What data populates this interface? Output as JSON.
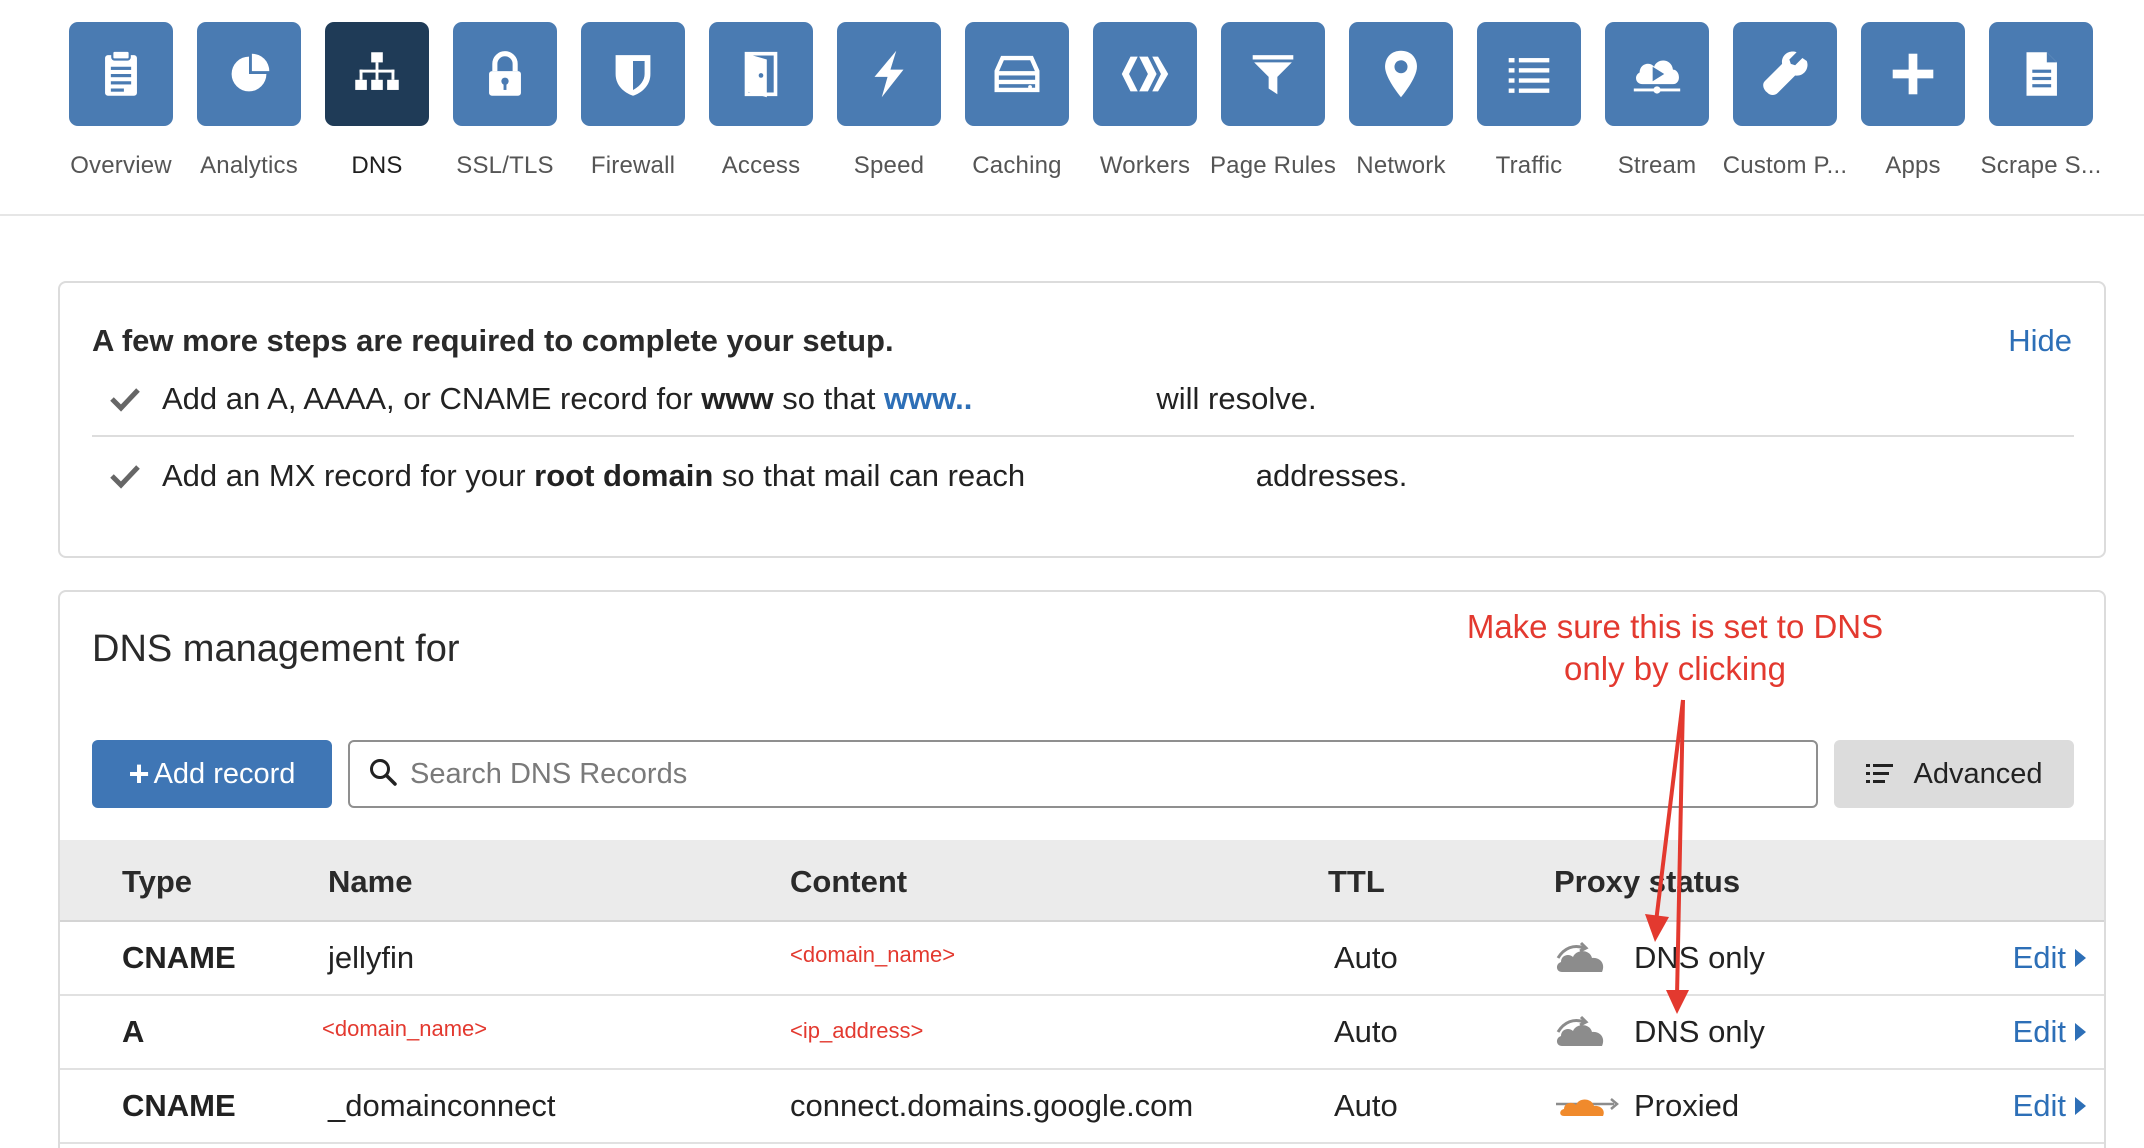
{
  "nav": {
    "items": [
      {
        "label": "Overview",
        "icon": "clipboard-icon"
      },
      {
        "label": "Analytics",
        "icon": "pie-chart-icon"
      },
      {
        "label": "DNS",
        "icon": "network-tree-icon",
        "active": true
      },
      {
        "label": "SSL/TLS",
        "icon": "lock-icon"
      },
      {
        "label": "Firewall",
        "icon": "shield-icon"
      },
      {
        "label": "Access",
        "icon": "door-icon"
      },
      {
        "label": "Speed",
        "icon": "lightning-icon"
      },
      {
        "label": "Caching",
        "icon": "server-icon"
      },
      {
        "label": "Workers",
        "icon": "workers-icon"
      },
      {
        "label": "Page Rules",
        "icon": "filter-icon"
      },
      {
        "label": "Network",
        "icon": "location-pin-icon"
      },
      {
        "label": "Traffic",
        "icon": "list-icon"
      },
      {
        "label": "Stream",
        "icon": "cloud-play-icon"
      },
      {
        "label": "Custom P...",
        "icon": "wrench-icon"
      },
      {
        "label": "Apps",
        "icon": "plus-icon"
      },
      {
        "label": "Scrape S...",
        "icon": "document-icon"
      }
    ]
  },
  "setup": {
    "title": "A few more steps are required to complete your setup.",
    "hide_label": "Hide",
    "step1": {
      "pre": "Add an A, AAAA, or CNAME record for ",
      "bold": "www",
      "mid": " so that ",
      "link": "www..",
      "post": "will resolve."
    },
    "step2": {
      "pre": "Add an MX record for your ",
      "bold": "root domain",
      "mid": " so that mail can reach ",
      "post": "addresses."
    }
  },
  "dns": {
    "title": "DNS management for",
    "add_label": "Add record",
    "search_placeholder": "Search DNS Records",
    "advanced_label": "Advanced",
    "headers": {
      "type": "Type",
      "name": "Name",
      "content": "Content",
      "ttl": "TTL",
      "proxy": "Proxy status"
    },
    "records": [
      {
        "type": "CNAME",
        "name": "jellyfin",
        "content": "<domain_name>",
        "ttl": "Auto",
        "proxy": "DNS only",
        "edit": "Edit"
      },
      {
        "type": "A",
        "name": "<domain_name>",
        "content": "<ip_address>",
        "ttl": "Auto",
        "proxy": "DNS only",
        "edit": "Edit"
      },
      {
        "type": "CNAME",
        "name": "_domainconnect",
        "content": "connect.domains.google.com",
        "ttl": "Auto",
        "proxy": "Proxied",
        "edit": "Edit"
      }
    ]
  },
  "annotation": {
    "line1": "Make sure this is set to DNS",
    "line2": "only by clicking",
    "color": "#e3392f"
  },
  "colors": {
    "accent": "#4a7bb2",
    "active_tile": "#1f3b57",
    "link": "#2d6fb7",
    "proxied_orange": "#f08a2c",
    "dns_only_gray": "#8c8c8c"
  }
}
